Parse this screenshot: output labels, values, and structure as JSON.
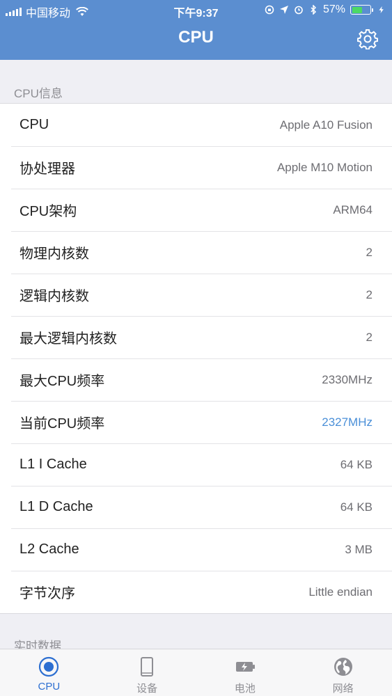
{
  "status_bar": {
    "carrier": "中国移动",
    "time": "下午9:37",
    "battery_percent": "57%",
    "battery_level": 0.57,
    "battery_color": "#4cd964"
  },
  "header": {
    "title": "CPU",
    "settings_icon": "gear-icon",
    "background_color": "#5b8ed0"
  },
  "cpu_info": {
    "section_title": "CPU信息",
    "rows": [
      {
        "label": "CPU",
        "value": "Apple A10 Fusion"
      },
      {
        "label": "协处理器",
        "value": "Apple M10 Motion"
      },
      {
        "label": "CPU架构",
        "value": "ARM64"
      },
      {
        "label": "物理内核数",
        "value": "2"
      },
      {
        "label": "逻辑内核数",
        "value": "2"
      },
      {
        "label": "最大逻辑内核数",
        "value": "2"
      },
      {
        "label": "最大CPU频率",
        "value": "2330MHz"
      },
      {
        "label": "当前CPU频率",
        "value": "2327MHz"
      },
      {
        "label": "L1 I Cache",
        "value": "64 KB"
      },
      {
        "label": "L1 D Cache",
        "value": "64 KB"
      },
      {
        "label": "L2 Cache",
        "value": "3 MB"
      },
      {
        "label": "字节次序",
        "value": "Little endian"
      }
    ],
    "accent_color": "#4a8fd8"
  },
  "realtime": {
    "section_title": "实时数据"
  },
  "tab_bar": {
    "active_color": "#2d6fd1",
    "tabs": [
      {
        "label": "CPU",
        "icon": "cpu-icon",
        "active": true
      },
      {
        "label": "设备",
        "icon": "device-icon",
        "active": false
      },
      {
        "label": "电池",
        "icon": "battery-icon",
        "active": false
      },
      {
        "label": "网络",
        "icon": "globe-icon",
        "active": false
      }
    ]
  }
}
